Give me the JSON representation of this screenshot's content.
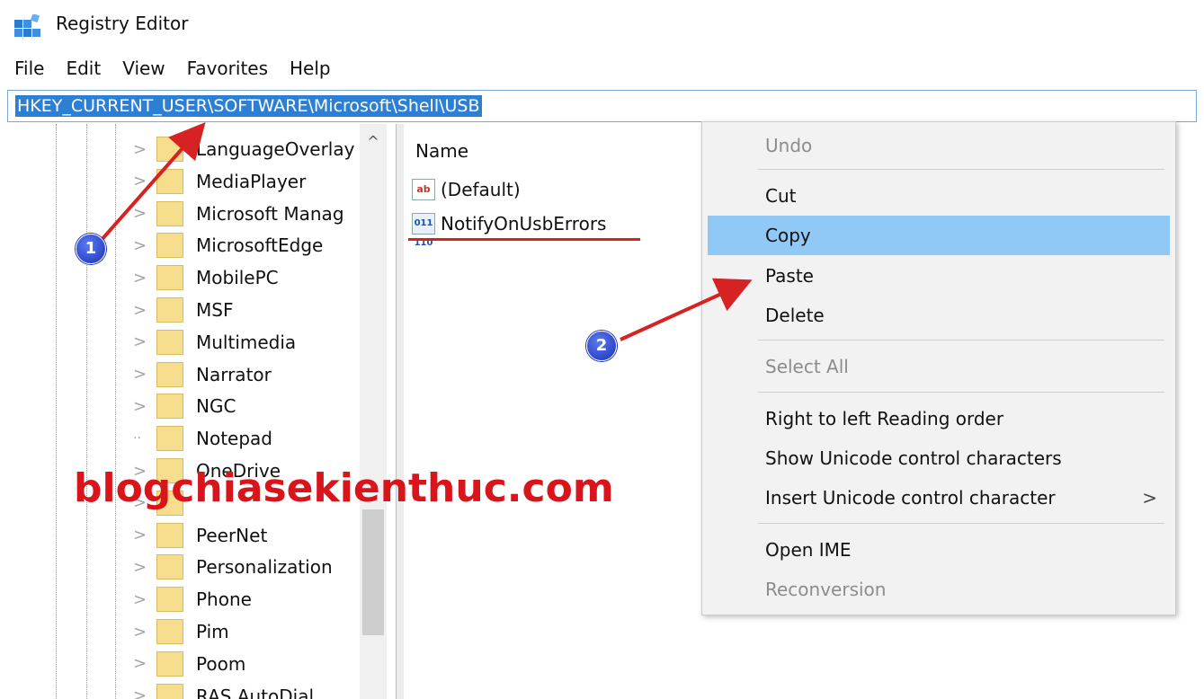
{
  "window": {
    "title": "Registry Editor"
  },
  "menubar": {
    "items": [
      "File",
      "Edit",
      "View",
      "Favorites",
      "Help"
    ]
  },
  "address": {
    "path": "HKEY_CURRENT_USER\\SOFTWARE\\Microsoft\\Shell\\USB"
  },
  "tree": {
    "items": [
      {
        "label": "LanguageOverlay",
        "expandable": true
      },
      {
        "label": "MediaPlayer",
        "expandable": true
      },
      {
        "label": "Microsoft Manag",
        "expandable": true
      },
      {
        "label": "MicrosoftEdge",
        "expandable": true
      },
      {
        "label": "MobilePC",
        "expandable": true
      },
      {
        "label": "MSF",
        "expandable": true
      },
      {
        "label": "Multimedia",
        "expandable": true
      },
      {
        "label": "Narrator",
        "expandable": true
      },
      {
        "label": "NGC",
        "expandable": true
      },
      {
        "label": "Notepad",
        "expandable": false
      },
      {
        "label": "OneDrive",
        "expandable": true
      },
      {
        "label": "",
        "expandable": true
      },
      {
        "label": "PeerNet",
        "expandable": true
      },
      {
        "label": "Personalization",
        "expandable": true
      },
      {
        "label": "Phone",
        "expandable": true
      },
      {
        "label": "Pim",
        "expandable": true
      },
      {
        "label": "Poom",
        "expandable": true
      },
      {
        "label": "RAS AutoDial",
        "expandable": true
      }
    ]
  },
  "values": {
    "column_name": "Name",
    "rows": [
      {
        "name": "(Default)",
        "icon": "string-value-icon",
        "icon_text": "ab"
      },
      {
        "name": "NotifyOnUsbErrors",
        "icon": "binary-value-icon",
        "icon_text": "011 110"
      }
    ]
  },
  "context_menu": {
    "items": [
      {
        "label": "Undo",
        "disabled": true
      },
      {
        "label": "Cut",
        "disabled": false
      },
      {
        "label": "Copy",
        "disabled": false,
        "highlighted": true
      },
      {
        "label": "Paste",
        "disabled": false
      },
      {
        "label": "Delete",
        "disabled": false
      },
      {
        "label": "Select All",
        "disabled": true
      },
      {
        "label": "Right to left Reading order",
        "disabled": false
      },
      {
        "label": "Show Unicode control characters",
        "disabled": false
      },
      {
        "label": "Insert Unicode control character",
        "disabled": false,
        "submenu_glyph": ">"
      },
      {
        "label": "Open IME",
        "disabled": false
      },
      {
        "label": "Reconversion",
        "disabled": true
      }
    ]
  },
  "annotations": {
    "badge_1": "1",
    "badge_2": "2",
    "watermark": "blogchiasekienthuc.com",
    "arrow_color": "#d62222"
  },
  "colors": {
    "selection": "#2d7fd3",
    "menu_highlight": "#90c8f6",
    "watermark": "#d9141b"
  }
}
